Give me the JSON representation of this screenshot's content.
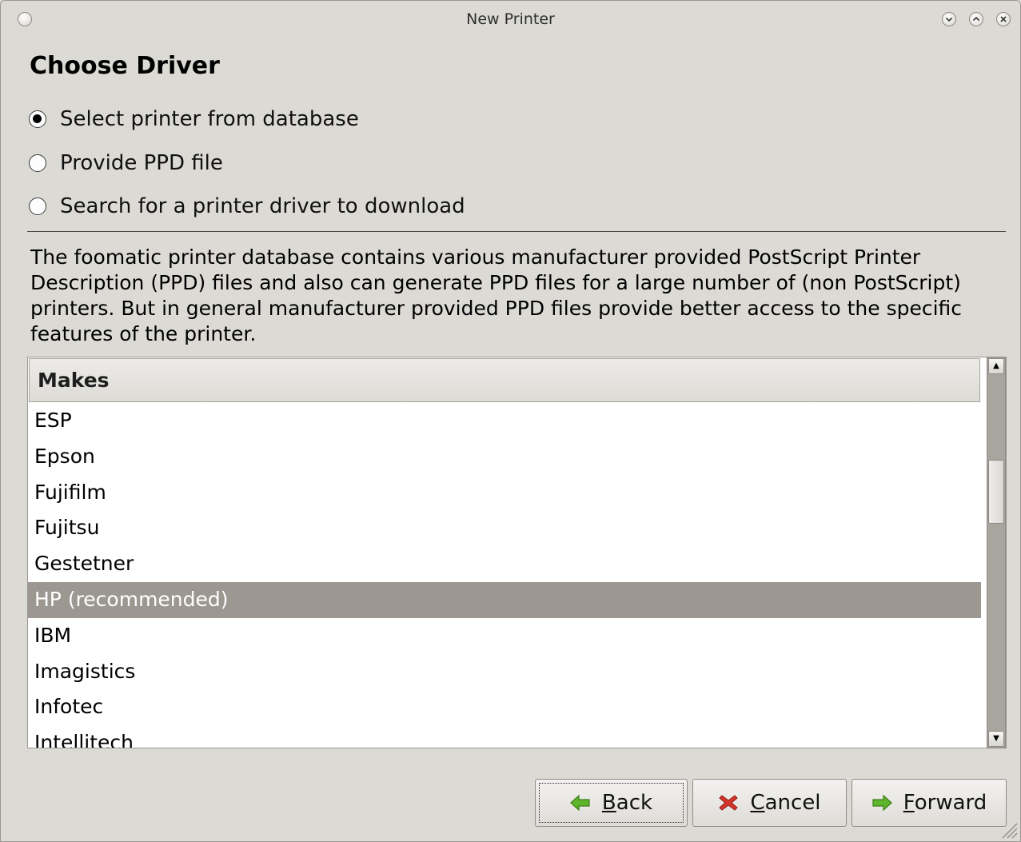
{
  "window": {
    "title": "New Printer"
  },
  "page": {
    "heading": "Choose Driver"
  },
  "options": [
    {
      "label": "Select printer from database",
      "checked": true
    },
    {
      "label": "Provide PPD file",
      "checked": false
    },
    {
      "label": "Search for a printer driver to download",
      "checked": false
    }
  ],
  "description": "The foomatic printer database contains various manufacturer provided PostScript Printer Description (PPD) files and also can generate PPD files for a large number of (non PostScript) printers. But in general manufacturer provided PPD files provide better access to the specific features of the printer.",
  "makes_list": {
    "header": "Makes",
    "selected": "HP (recommended)",
    "items": [
      "ESP",
      "Epson",
      "Fujifilm",
      "Fujitsu",
      "Gestetner",
      "HP (recommended)",
      "IBM",
      "Imagistics",
      "Infotec",
      "Intellitech"
    ]
  },
  "buttons": {
    "back": {
      "mnemonic": "B",
      "rest": "ack",
      "icon": "green-left-arrow-icon"
    },
    "cancel": {
      "mnemonic": "C",
      "rest": "ancel",
      "icon": "red-x-icon"
    },
    "forward": {
      "mnemonic": "F",
      "rest": "orward",
      "icon": "green-right-arrow-icon"
    }
  },
  "colors": {
    "window_bg": "#dcdad5",
    "selection_bg": "#9c9891",
    "selection_fg": "#ffffff",
    "arrow_green": "#5fb52c",
    "cancel_red": "#d8352a"
  }
}
